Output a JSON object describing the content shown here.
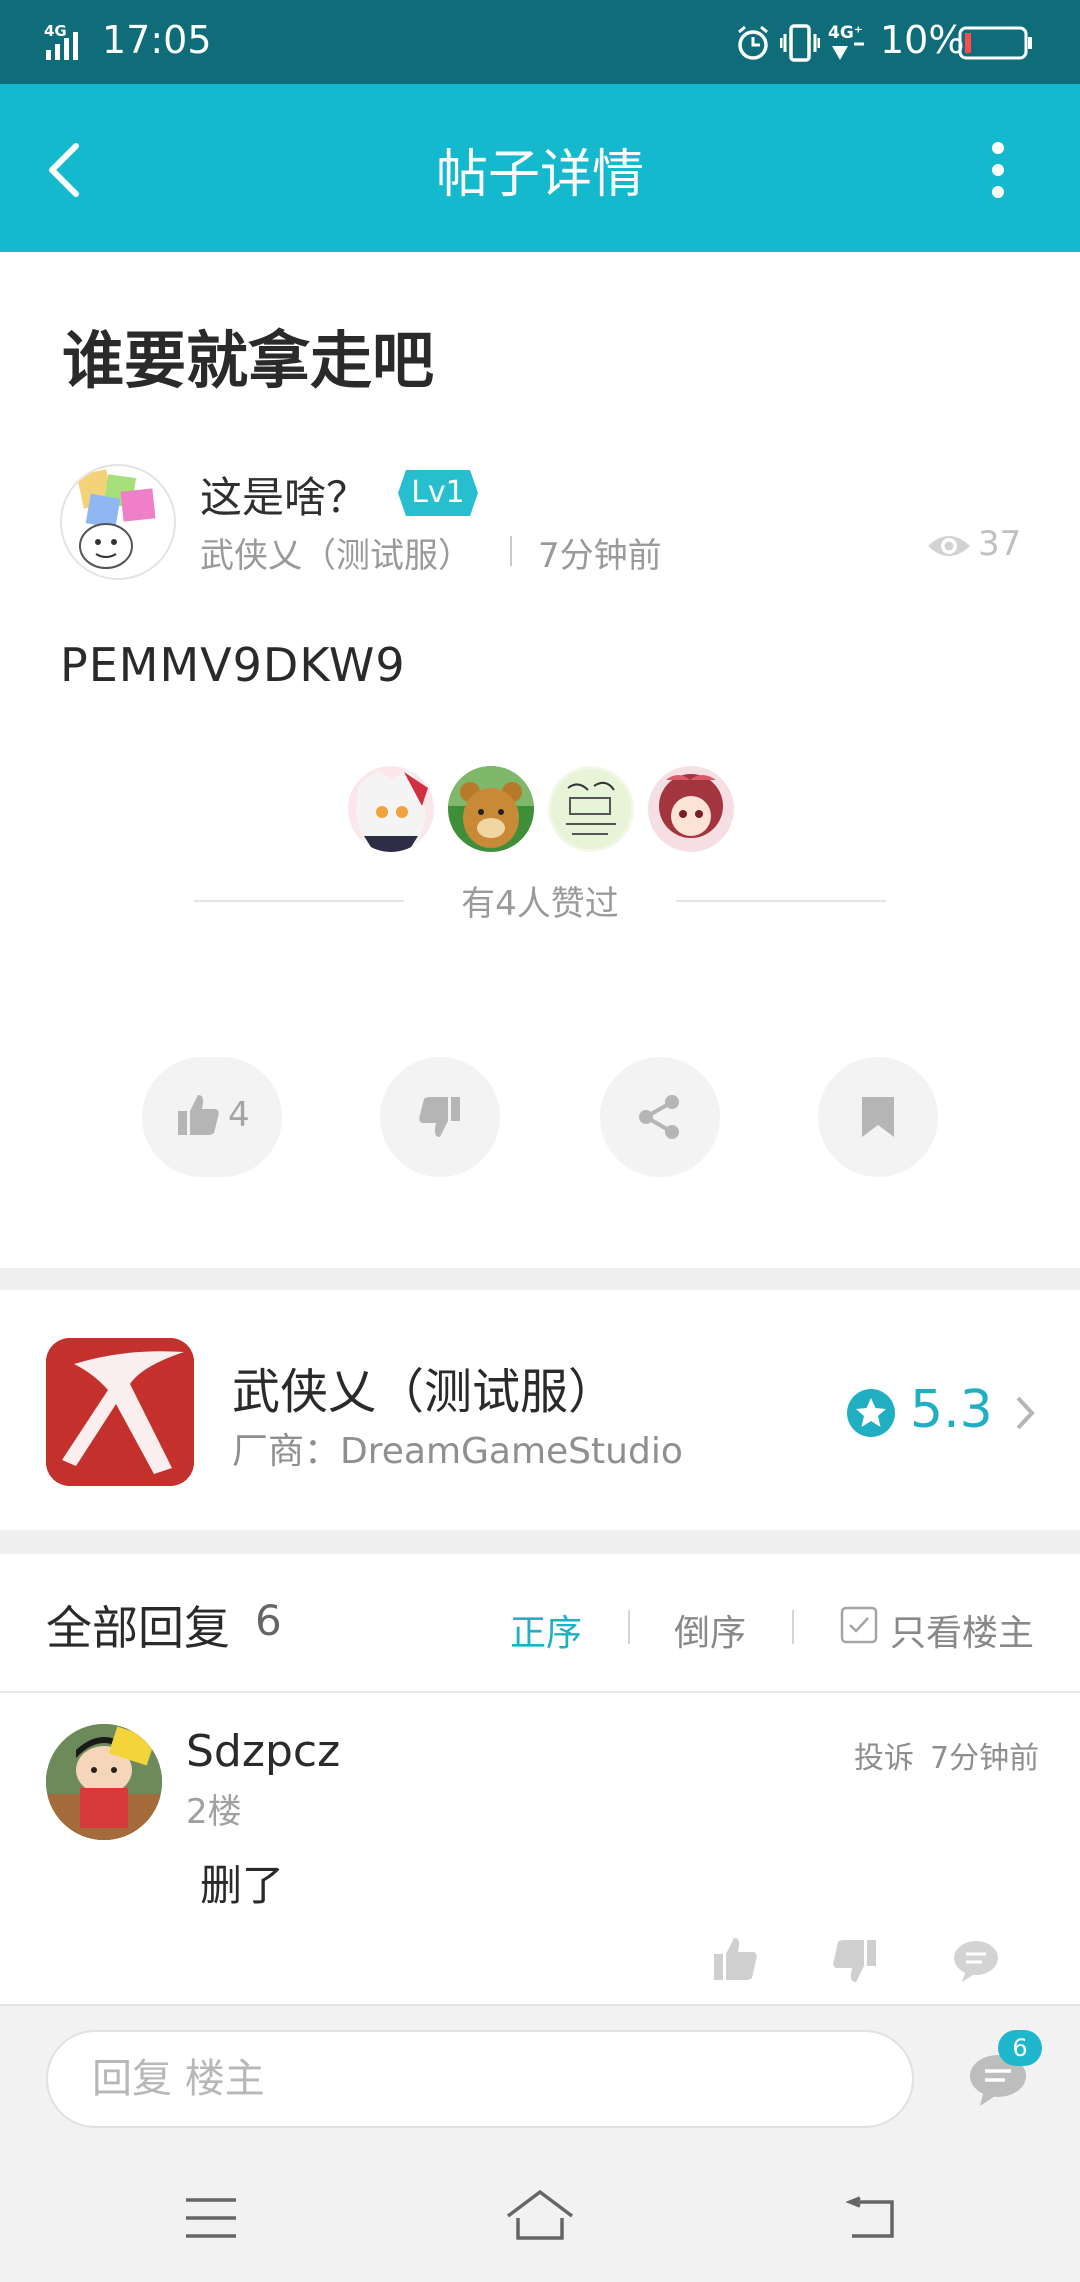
{
  "status_bar": {
    "network": "4G",
    "time": "17:05",
    "network_right": "4G⁺",
    "battery": "10%"
  },
  "header": {
    "title": "帖子详情"
  },
  "post": {
    "title": "谁要就拿走吧",
    "author": "这是啥？",
    "level": "Lv1",
    "game": "武侠乂（测试服）",
    "time": "7分钟前",
    "views": "37",
    "content": "PEMMV9DKW9",
    "likers_text": "有4人赞过",
    "like_count": "4"
  },
  "app_card": {
    "name": "武侠乂（测试服）",
    "vendor": "厂商：DreamGameStudio",
    "rating": "5.3",
    "icon_char": "乂"
  },
  "replies": {
    "heading": "全部回复",
    "count": "6",
    "sort_asc": "正序",
    "sort_desc": "倒序",
    "only_host": "只看楼主"
  },
  "comment": {
    "name": "Sdzpcz",
    "floor": "2楼",
    "report": "投诉",
    "time": "7分钟前",
    "text": "删了"
  },
  "bottom": {
    "placeholder": "回复  楼主",
    "comment_badge": "6"
  },
  "colors": {
    "accent": "#15b9cd",
    "status_bar": "#0f6d79",
    "app_icon": "#c4302b"
  }
}
